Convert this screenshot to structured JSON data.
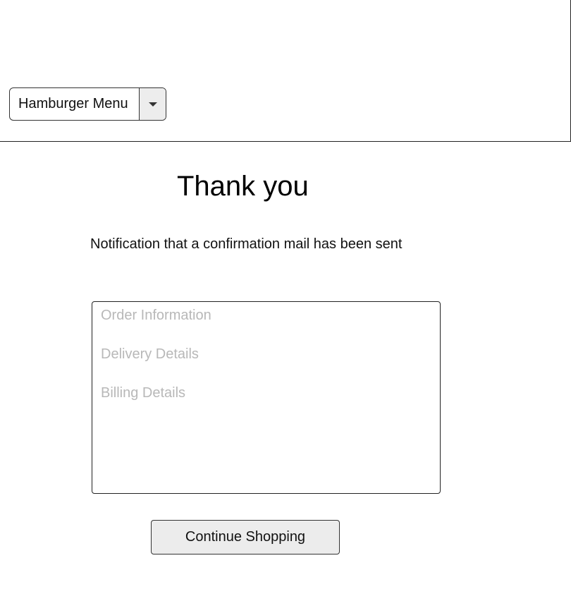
{
  "header": {
    "menu_select": {
      "selected_label": "Hamburger Menu",
      "toggle_icon": "caret-down-icon"
    }
  },
  "main": {
    "title": "Thank you",
    "notification": "Notification that a confirmation mail has been sent",
    "order_summary": {
      "lines": [
        "Order Information",
        "Delivery Details",
        "Billing Details"
      ]
    },
    "continue_button_label": "Continue Shopping"
  },
  "colors": {
    "placeholder_text": "#b8b8b8",
    "button_background": "#ececec",
    "toggle_background": "#ededed",
    "border": "#333333"
  }
}
